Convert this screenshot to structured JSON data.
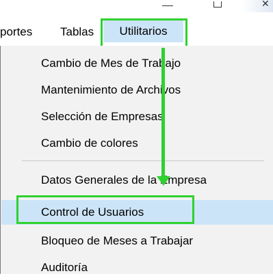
{
  "menubar": {
    "items": [
      {
        "label": "portes"
      },
      {
        "label": "Tablas"
      },
      {
        "label": "Utilitarios"
      }
    ]
  },
  "dropdown": {
    "items": [
      {
        "label": "Cambio de Mes de Trabajo"
      },
      {
        "label": "Mantenimiento de Archivos"
      },
      {
        "label": "Selección de Empresas"
      },
      {
        "label": "Cambio de colores"
      },
      {
        "label": "Datos Generales de la Empresa"
      },
      {
        "label": "Control de Usuarios"
      },
      {
        "label": "Bloqueo de Meses a Trabajar"
      },
      {
        "label": "Auditoría"
      }
    ],
    "selected": "Control de Usuarios"
  },
  "annotations": {
    "highlight_color": "#2fd12f",
    "selection_color": "#cce4f7"
  }
}
